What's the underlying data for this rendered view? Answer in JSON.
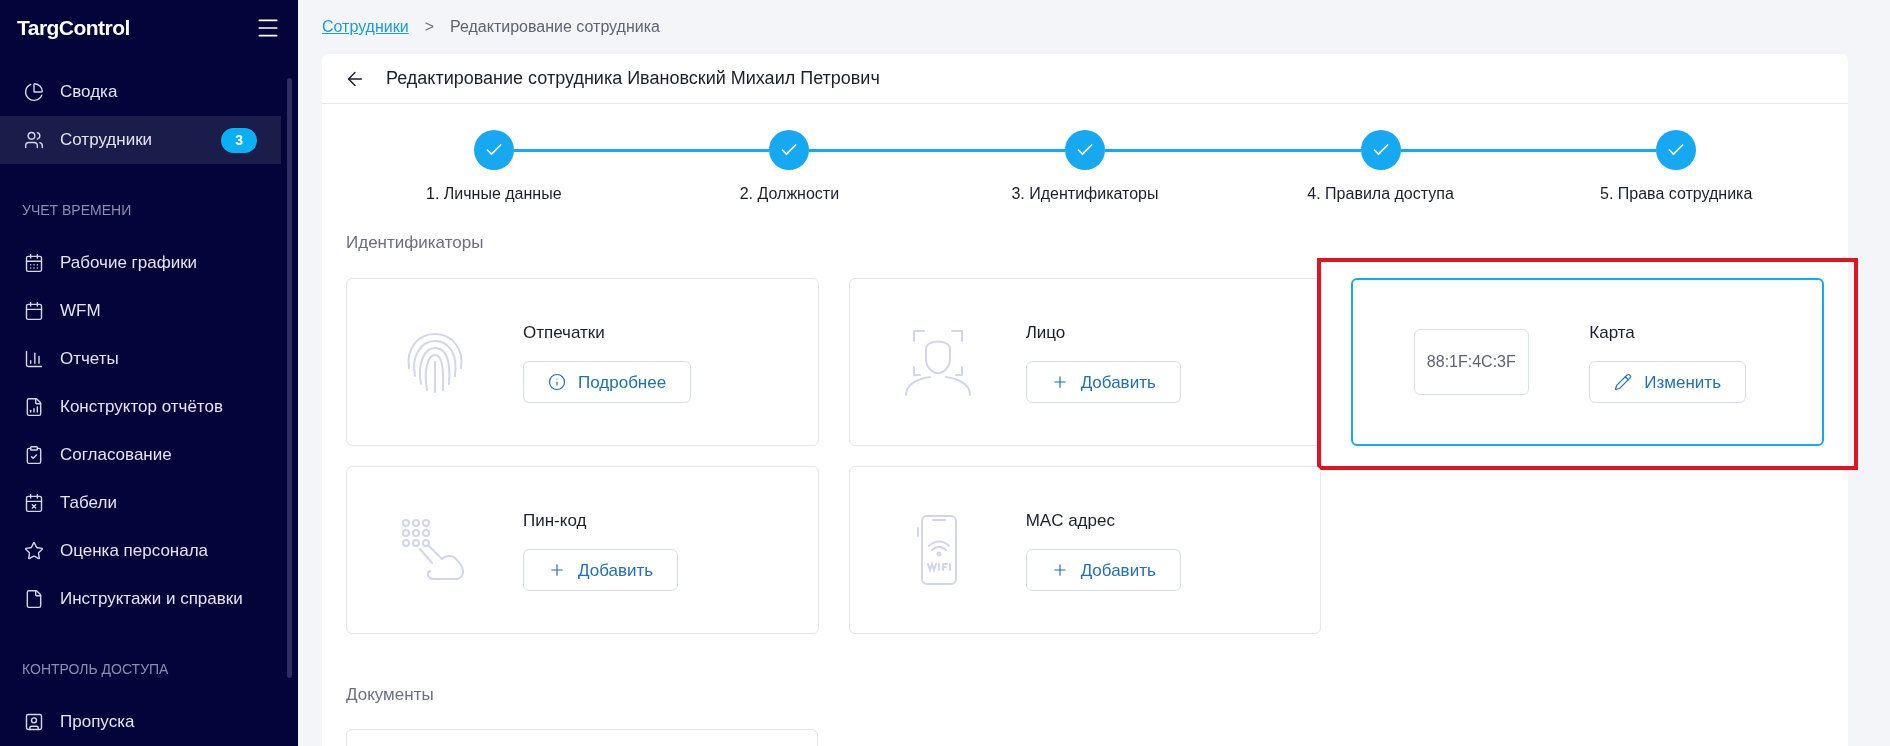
{
  "sidebar": {
    "logo": "TargControl",
    "sections": [
      {
        "items": [
          {
            "label": "Сводка",
            "selected": false
          },
          {
            "label": "Сотрудники",
            "selected": true,
            "badge": "3"
          }
        ]
      },
      {
        "heading": "УЧЕТ ВРЕМЕНИ",
        "items": [
          {
            "label": "Рабочие графики",
            "selected": false
          },
          {
            "label": "WFM",
            "selected": false
          },
          {
            "label": "Отчеты",
            "selected": false
          },
          {
            "label": "Конструктор отчётов",
            "selected": false
          },
          {
            "label": "Согласование",
            "selected": false
          },
          {
            "label": "Табели",
            "selected": false
          },
          {
            "label": "Оценка персонала",
            "selected": false
          },
          {
            "label": "Инструктажи и справки",
            "selected": false
          }
        ]
      },
      {
        "heading": "КОНТРОЛЬ ДОСТУПА",
        "items": [
          {
            "label": "Пропуска",
            "selected": false
          }
        ]
      }
    ]
  },
  "breadcrumb": {
    "link": "Сотрудники",
    "separator": ">",
    "current": "Редактирование сотрудника"
  },
  "page_title": "Редактирование сотрудника Ивановский Михаил Петрович",
  "steps": [
    {
      "label": "1. Личные данные",
      "done": true
    },
    {
      "label": "2. Должности",
      "done": true
    },
    {
      "label": "3. Идентификаторы",
      "done": true
    },
    {
      "label": "4. Правила доступа",
      "done": true
    },
    {
      "label": "5. Права сотрудника",
      "done": true
    }
  ],
  "identifiers": {
    "heading": "Идентификаторы",
    "cards": [
      {
        "kind": "fingerprints",
        "title": "Отпечатки",
        "selected": false,
        "highlighted": false,
        "button": {
          "kind": "details",
          "label": "Подробнее"
        }
      },
      {
        "kind": "face",
        "title": "Лицо",
        "selected": false,
        "highlighted": false,
        "button": {
          "kind": "add",
          "label": "Добавить"
        }
      },
      {
        "kind": "card",
        "title": "Карта",
        "value": "88:1F:4C:3F",
        "selected": true,
        "highlighted": true,
        "button": {
          "kind": "edit",
          "label": "Изменить"
        }
      },
      {
        "kind": "pin",
        "title": "Пин-код",
        "selected": false,
        "highlighted": false,
        "button": {
          "kind": "add",
          "label": "Добавить"
        }
      },
      {
        "kind": "mac",
        "title": "MAC адрес",
        "selected": false,
        "highlighted": false,
        "button": {
          "kind": "add",
          "label": "Добавить"
        }
      }
    ]
  },
  "documents": {
    "heading": "Документы"
  }
}
